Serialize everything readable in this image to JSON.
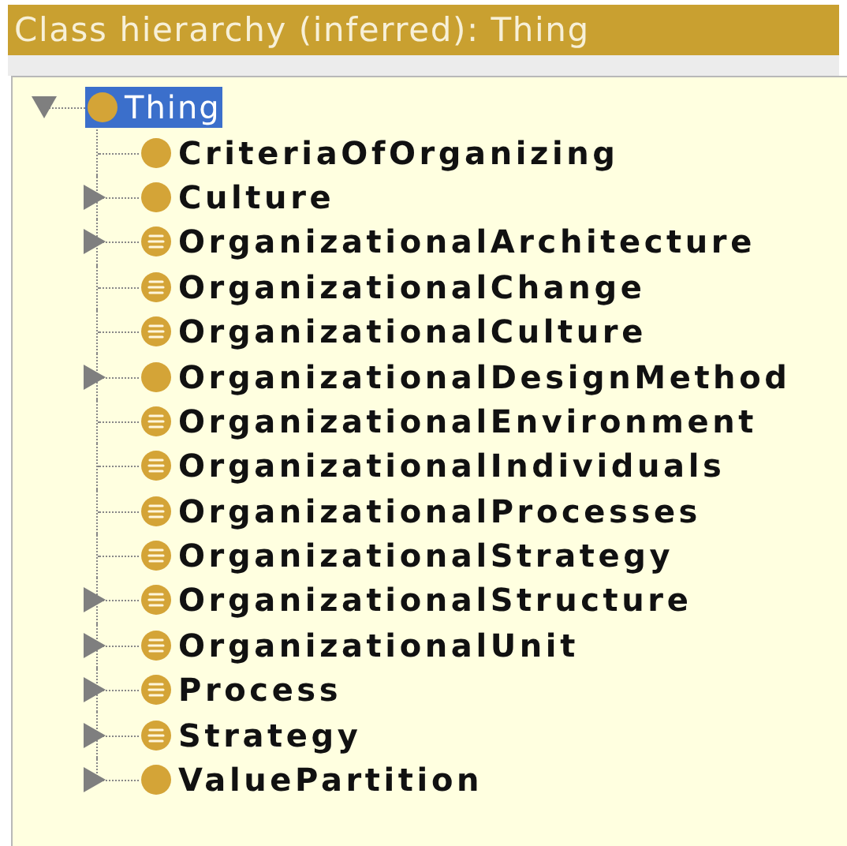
{
  "panel": {
    "title": "Class hierarchy (inferred): Thing"
  },
  "tree": {
    "label": "Thing",
    "kind": "primitive",
    "selected": true,
    "expanded": true,
    "children": [
      {
        "label": "CriteriaOfOrganizing",
        "kind": "primitive",
        "expandable": false
      },
      {
        "label": "Culture",
        "kind": "primitive",
        "expandable": true
      },
      {
        "label": "OrganizationalArchitecture",
        "kind": "defined",
        "expandable": true
      },
      {
        "label": "OrganizationalChange",
        "kind": "defined",
        "expandable": false
      },
      {
        "label": "OrganizationalCulture",
        "kind": "defined",
        "expandable": false
      },
      {
        "label": "OrganizationalDesignMethod",
        "kind": "primitive",
        "expandable": true
      },
      {
        "label": "OrganizationalEnvironment",
        "kind": "defined",
        "expandable": false
      },
      {
        "label": "OrganizationalIndividuals",
        "kind": "defined",
        "expandable": false
      },
      {
        "label": "OrganizationalProcesses",
        "kind": "defined",
        "expandable": false
      },
      {
        "label": "OrganizationalStrategy",
        "kind": "defined",
        "expandable": false
      },
      {
        "label": "OrganizationalStructure",
        "kind": "defined",
        "expandable": true
      },
      {
        "label": "OrganizationalUnit",
        "kind": "defined",
        "expandable": true
      },
      {
        "label": "Process",
        "kind": "defined",
        "expandable": true
      },
      {
        "label": "Strategy",
        "kind": "defined",
        "expandable": true
      },
      {
        "label": "ValuePartition",
        "kind": "primitive",
        "expandable": true
      }
    ]
  }
}
